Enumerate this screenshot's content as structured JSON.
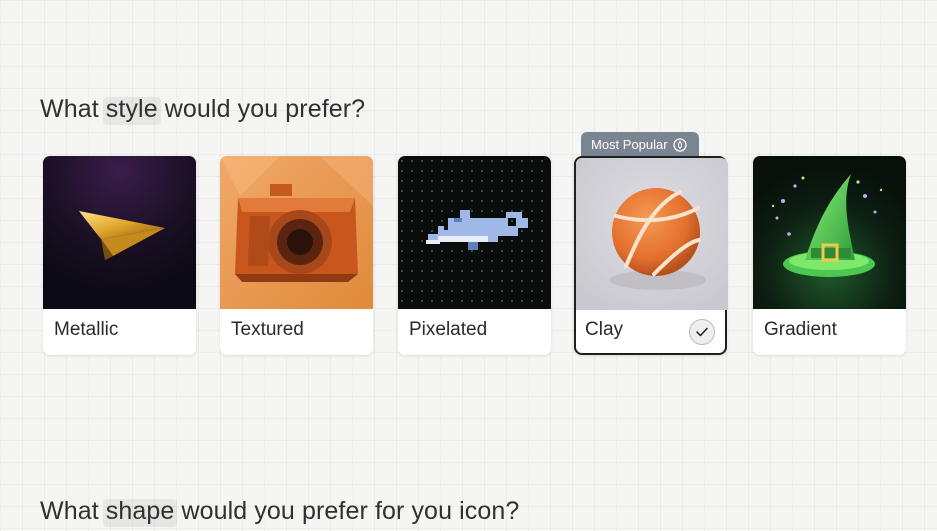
{
  "sections": {
    "style_heading_prefix": "What ",
    "style_heading_highlight": "style",
    "style_heading_suffix": " would you prefer?",
    "shape_heading_prefix": "What ",
    "shape_heading_highlight": "shape",
    "shape_heading_suffix": " would you prefer for you icon?"
  },
  "badge": {
    "label": "Most Popular",
    "icon": "flame-icon"
  },
  "styles": [
    {
      "label": "Metallic",
      "selected": false
    },
    {
      "label": "Textured",
      "selected": false
    },
    {
      "label": "Pixelated",
      "selected": false
    },
    {
      "label": "Clay",
      "selected": true
    },
    {
      "label": "Gradient",
      "selected": false
    }
  ],
  "colors": {
    "selected_border": "#1f1f1f",
    "badge_bg": "#7b8591"
  }
}
